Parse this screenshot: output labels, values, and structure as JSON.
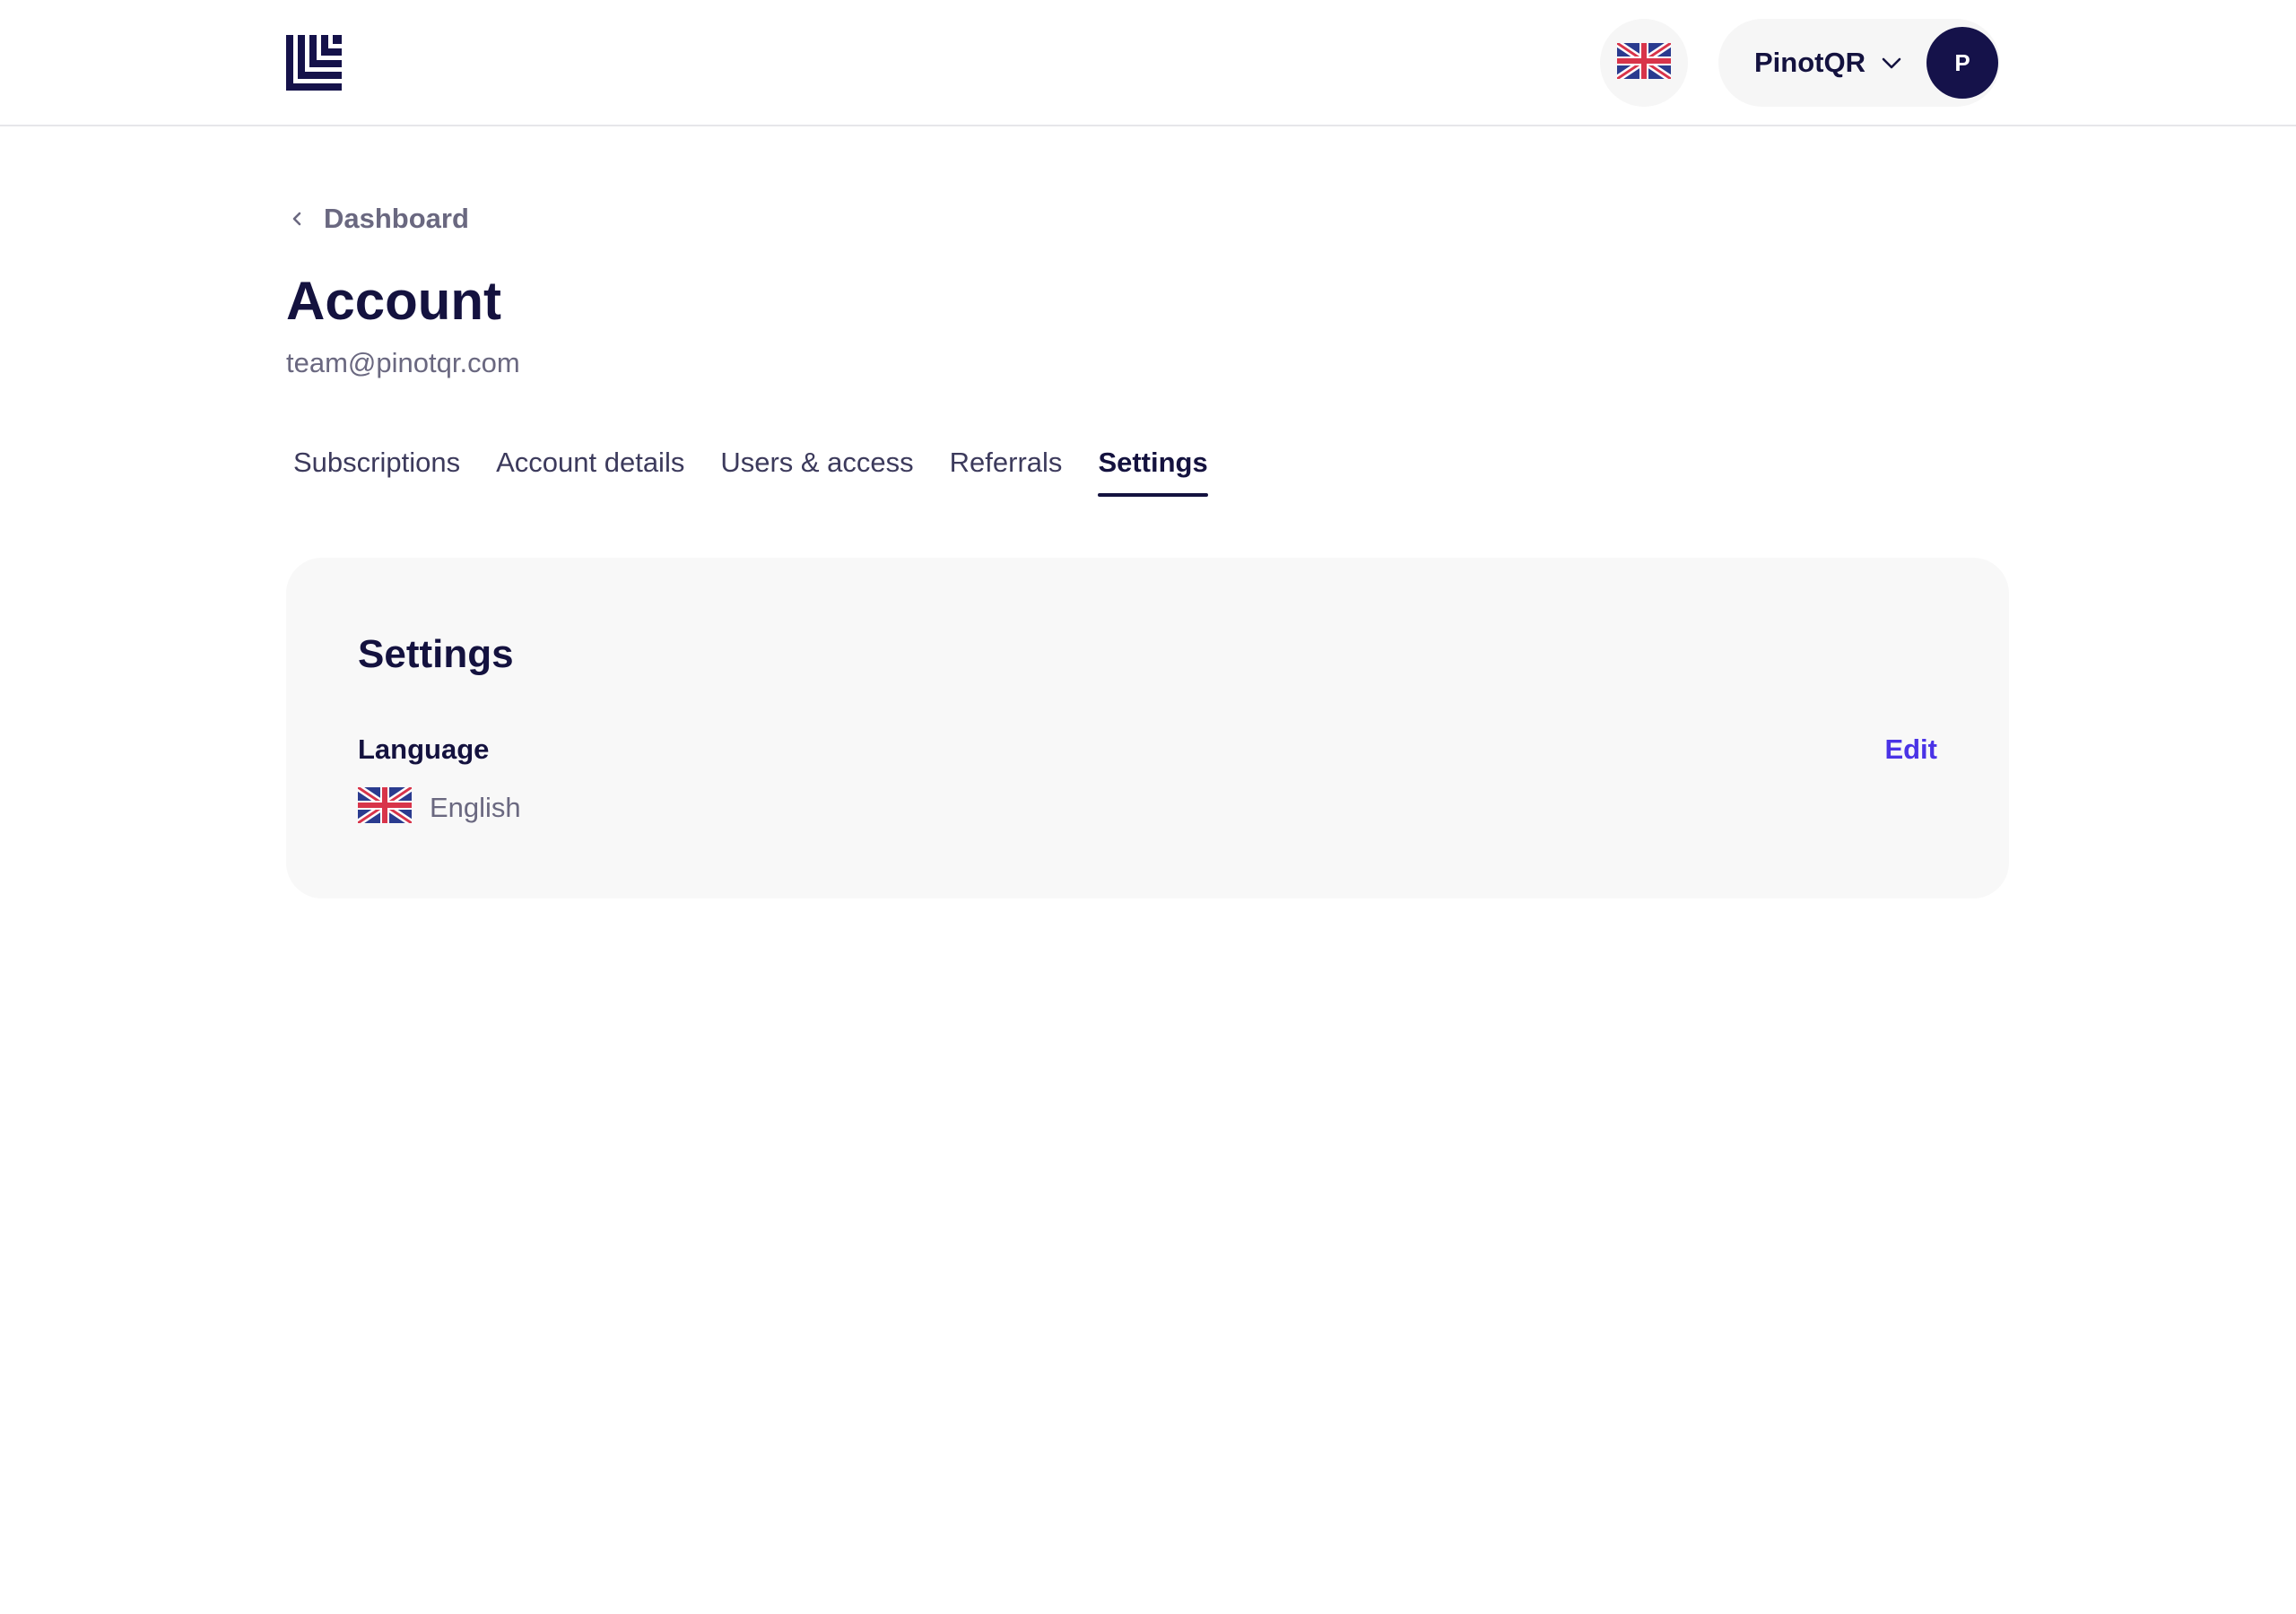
{
  "header": {
    "logo_icon": "brand-logo-icon",
    "language_icon": "uk-flag-icon",
    "user_name": "PinotQR",
    "dropdown_icon": "chevron-down-icon",
    "avatar_initial": "P"
  },
  "breadcrumb": {
    "icon": "chevron-left-icon",
    "label": "Dashboard"
  },
  "page": {
    "title": "Account",
    "email": "team@pinotqr.com"
  },
  "tabs": [
    {
      "label": "Subscriptions",
      "active": false
    },
    {
      "label": "Account details",
      "active": false
    },
    {
      "label": "Users & access",
      "active": false
    },
    {
      "label": "Referrals",
      "active": false
    },
    {
      "label": "Settings",
      "active": true
    }
  ],
  "settings_card": {
    "title": "Settings",
    "language_label": "Language",
    "language_value": "English",
    "language_flag_icon": "uk-flag-icon",
    "edit_label": "Edit"
  },
  "colors": {
    "navy": "#14123f",
    "avatar_bg": "#15124a",
    "accent_link": "#4a33e6",
    "muted_text": "#6a6880",
    "card_bg": "#f8f8f8"
  }
}
